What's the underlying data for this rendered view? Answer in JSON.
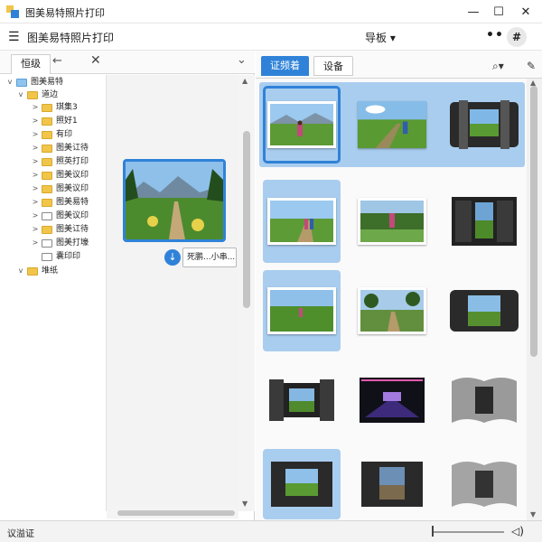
{
  "window": {
    "title": "图美易特照片打印",
    "minimize": "—",
    "maximize": "☐",
    "close": "✕"
  },
  "toolbar": {
    "menu_icon": "☰",
    "title": "图美易特照片打印",
    "nav_dropdown": "导板 ▾",
    "more": "••",
    "sharp": "#"
  },
  "left_panel": {
    "tab_label": "恒级",
    "back_icon": "←",
    "close_icon": "✕",
    "collapse_icon": "⌄"
  },
  "tree": [
    {
      "label": "图美易特",
      "toggle": "v",
      "icon": "blue-folder-icon"
    },
    {
      "label": "道边",
      "toggle": "v",
      "icon": "folder-icon"
    },
    {
      "label": "琪集3",
      "toggle": ">",
      "icon": "folder-icon"
    },
    {
      "label": "照好1",
      "toggle": ">",
      "icon": "folder-icon"
    },
    {
      "label": "有印",
      "toggle": ">",
      "icon": "folder-icon"
    },
    {
      "label": "图美讧待",
      "toggle": ">",
      "icon": "folder-icon"
    },
    {
      "label": "照英打印",
      "toggle": ">",
      "icon": "folder-icon"
    },
    {
      "label": "图美议印",
      "toggle": ">",
      "icon": "folder-icon"
    },
    {
      "label": "图美议印",
      "toggle": ">",
      "icon": "folder-icon"
    },
    {
      "label": "图美易特",
      "toggle": ">",
      "icon": "folder-icon"
    },
    {
      "label": "图美议印",
      "toggle": ">",
      "icon": "outline-folder-icon"
    },
    {
      "label": "图美讧待",
      "toggle": ">",
      "icon": "folder-icon"
    },
    {
      "label": "图美打壕",
      "toggle": ">",
      "icon": "outline-folder-icon"
    },
    {
      "label": "囊印印",
      "toggle": "",
      "icon": "outline-folder-icon"
    },
    {
      "label": "堆纸",
      "toggle": "v",
      "icon": "folder-icon"
    }
  ],
  "preview": {
    "tooltip": "死鹏...小串...",
    "download_icon": "↓"
  },
  "right_panel": {
    "tab_active": "证频着",
    "tab_inactive": "设备",
    "search_icon": "⌕▾",
    "edit_icon": "✎"
  },
  "status": {
    "text": "议溢证",
    "sound_icon": "◁)"
  }
}
